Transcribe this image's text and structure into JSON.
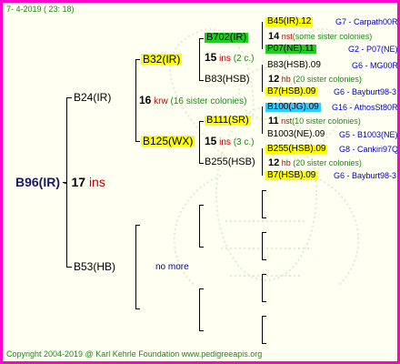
{
  "header": {
    "date": "7-   4-2019  ( 23:  18)"
  },
  "footer": {
    "copyright": "Copyright 2004-2019 @ Karl Kehrle Foundation   www.pedigreeapis.org"
  },
  "colors": {
    "border": "#ff00cc",
    "yellow": "#ffff00",
    "green": "#22cc22",
    "cyan": "#33ccff",
    "text_green": "#1a8a1a",
    "text_red": "#c00000",
    "text_blue": "#0000cc"
  },
  "root": {
    "id": "B96(IR)",
    "gen": "17",
    "note": "ins"
  },
  "father": {
    "id": "B24(IR)"
  },
  "mother": {
    "id": "B53(HB)",
    "note": "no more"
  },
  "gen16": {
    "gen": "16",
    "ins": "krw",
    "note": "(16 sister colonies)"
  },
  "b32": {
    "id": "B32(IR)"
  },
  "b125": {
    "id": "B125(WX)"
  },
  "b702": {
    "id": "B702(IR)",
    "gen": "15",
    "ins": "ins",
    "note": "(2 c.)"
  },
  "b83": {
    "id": "B83(HSB)"
  },
  "b111": {
    "id": "B111(SR)",
    "gen": "15",
    "ins": "ins",
    "note": "(3 c.)"
  },
  "b255": {
    "id": "B255(HSB)"
  },
  "leaves": [
    {
      "id": "B45(IR).12",
      "info": "G7 - Carpath00R"
    },
    {
      "gen": "14",
      "ins": "nst",
      "note": "(some sister colonies)"
    },
    {
      "id": "P07(NE).11",
      "info": "G2 - P07(NE)"
    },
    {
      "id": "B83(HSB).09",
      "info": "G6 - MG00R"
    },
    {
      "gen": "12",
      "ins": "hb",
      "note": "(20 sister colonies)"
    },
    {
      "id": "B7(HSB).09",
      "info": "G6 - Bayburt98-3"
    },
    {
      "id": "B100(JG).09",
      "info": "G16 - AthosSt80R"
    },
    {
      "gen": "11",
      "ins": "nst",
      "note": "(10 sister colonies)"
    },
    {
      "id": "B1003(NE).09",
      "info": "G5 - B1003(NE)"
    },
    {
      "id": "B255(HSB).09",
      "info": "G8 - Cankiri97Q"
    },
    {
      "gen": "12",
      "ins": "hb",
      "note": "(20 sister colonies)"
    },
    {
      "id": "B7(HSB).09",
      "info": "G6 - Bayburt98-3"
    }
  ]
}
